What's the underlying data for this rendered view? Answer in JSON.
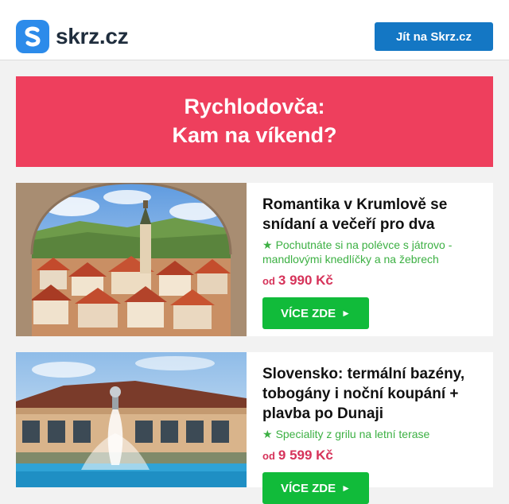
{
  "header": {
    "logo_text": "skrz.cz",
    "cta_label": "Jít na Skrz.cz"
  },
  "hero": {
    "line1": "Rychlodovča:",
    "line2": "Kam na víkend?",
    "color": "#ee3f5d"
  },
  "offers": [
    {
      "title": "Romantika v Krumlově se snídaní a večeří pro dva",
      "perk": "Pochutnáte si na polévce s játrovo - mandlovými knedlíčky a na žebrech",
      "price_prefix": "od",
      "price": "3 990 Kč",
      "button_label": "VÍCE ZDE",
      "image": "cesky-krumlov-town-through-stone-arch"
    },
    {
      "title": "Slovensko: termální bazény, tobogány i noční koupání + plavba po Dunaji",
      "perk": "Speciality z grilu na letní terase",
      "price_prefix": "od",
      "price": "9 599 Kč",
      "button_label": "VÍCE ZDE",
      "image": "thermal-spa-fountain-pool"
    }
  ],
  "colors": {
    "brand_blue": "#2c8bea",
    "cta_blue": "#1477c4",
    "perk_green": "#3cb043",
    "price_pink": "#d6335a",
    "button_green": "#11bb3a"
  },
  "icons": {
    "perk": "star-icon",
    "button": "arrow-right-icon"
  }
}
